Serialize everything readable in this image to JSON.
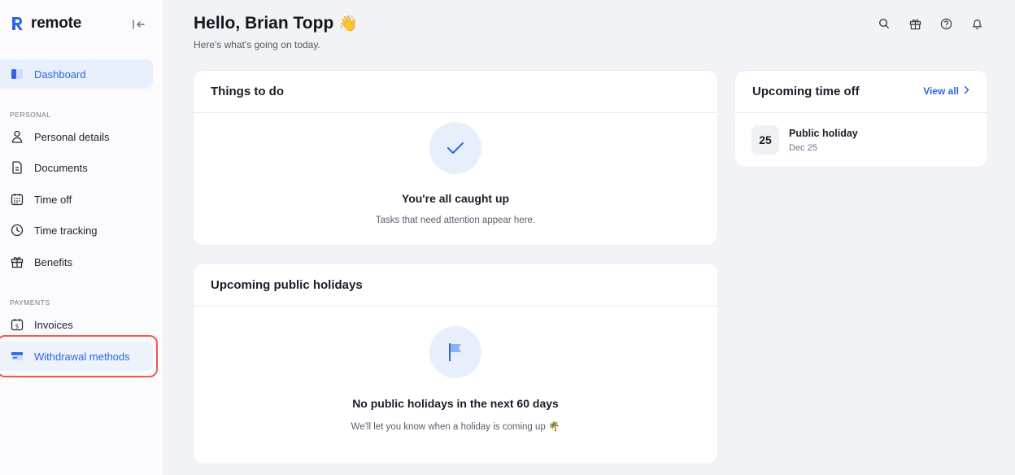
{
  "brand": {
    "name": "remote"
  },
  "sidebar": {
    "dashboard": "Dashboard",
    "personal_section": "PERSONAL",
    "payments_section": "PAYMENTS",
    "items": [
      {
        "label": "Personal details",
        "icon": "person-icon"
      },
      {
        "label": "Documents",
        "icon": "document-icon"
      },
      {
        "label": "Time off",
        "icon": "calendar-icon"
      },
      {
        "label": "Time tracking",
        "icon": "clock-icon"
      },
      {
        "label": "Benefits",
        "icon": "gift-icon"
      }
    ],
    "payments": [
      {
        "label": "Invoices",
        "icon": "invoice-icon"
      },
      {
        "label": "Withdrawal methods",
        "icon": "card-icon"
      }
    ]
  },
  "header": {
    "greeting": "Hello, Brian Topp",
    "greeting_emoji": "👋",
    "subtitle": "Here's what's going on today."
  },
  "todo": {
    "title": "Things to do",
    "empty_title": "You're all caught up",
    "empty_sub": "Tasks that need attention appear here."
  },
  "holidays": {
    "title": "Upcoming public holidays",
    "empty_title": "No public holidays in the next 60 days",
    "empty_sub": "We'll let you know when a holiday is coming up 🌴"
  },
  "timeoff": {
    "title": "Upcoming time off",
    "view_all": "View all",
    "item": {
      "day": "25",
      "name": "Public holiday",
      "date": "Dec 25"
    }
  },
  "colors": {
    "accent": "#2d65e6",
    "highlight": "#ef5a4a"
  }
}
